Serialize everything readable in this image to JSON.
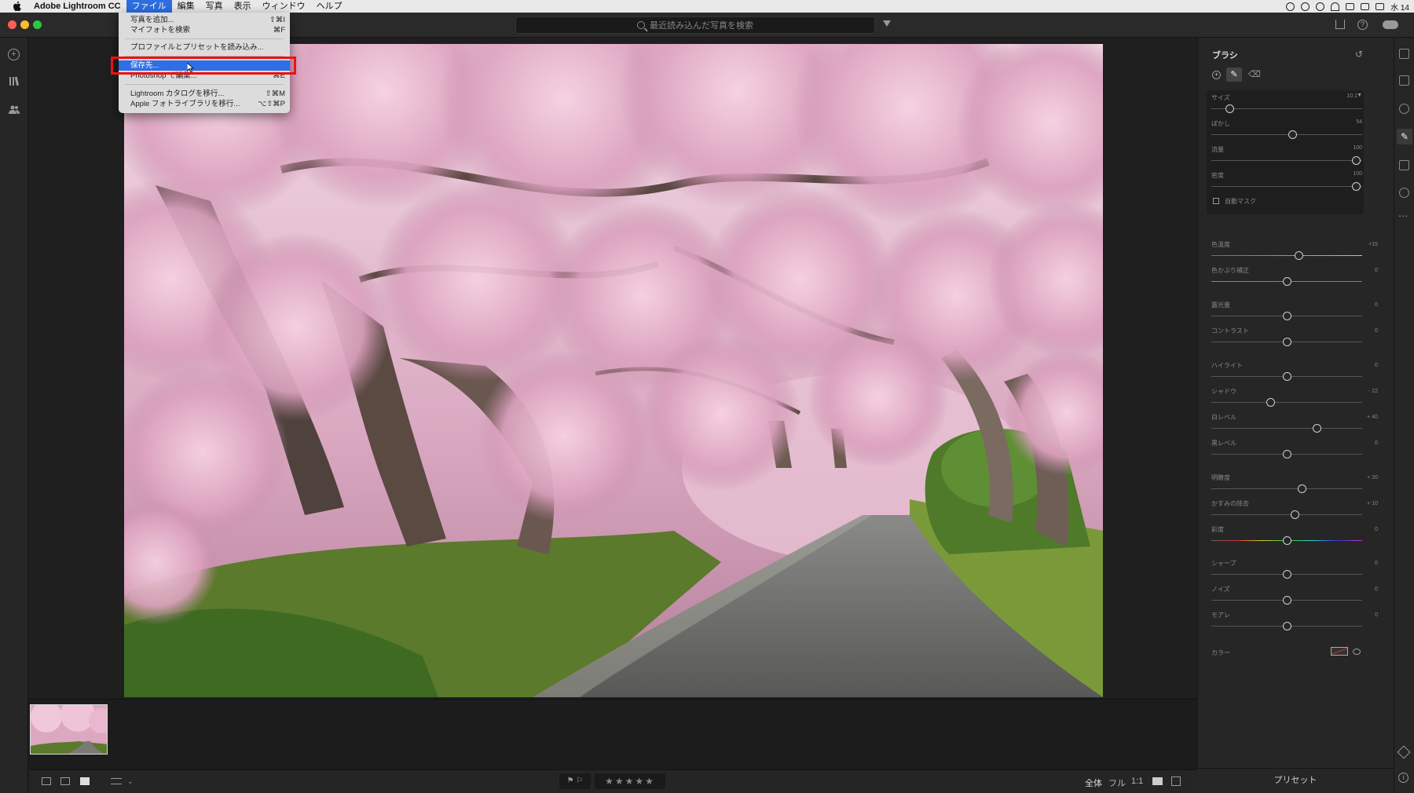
{
  "menubar": {
    "app_name": "Adobe Lightroom CC",
    "items": [
      "ファイル",
      "編集",
      "写真",
      "表示",
      "ウィンドウ",
      "ヘルプ"
    ],
    "clock": "水 14"
  },
  "toolbar": {
    "search_placeholder": "最近読み込んだ写真を検索"
  },
  "file_menu": {
    "items": [
      {
        "label": "写真を追加...",
        "shortcut": "⇧⌘I"
      },
      {
        "label": "マイフォトを検索",
        "shortcut": "⌘F"
      },
      {
        "label": "プロファイルとプリセットを読み込み...",
        "shortcut": ""
      },
      {
        "label": "保存先...",
        "shortcut": ""
      },
      {
        "label": "Photoshop で編集...",
        "shortcut": "⌘E"
      },
      {
        "label": "Lightroom カタログを移行...",
        "shortcut": "⇧⌘M"
      },
      {
        "label": "Apple フォトライブラリを移行...",
        "shortcut": "⌥⇧⌘P"
      }
    ],
    "highlighted": "保存先..."
  },
  "brush_panel": {
    "title": "ブラシ",
    "size": {
      "label": "サイズ",
      "value": "10.1"
    },
    "feather": {
      "label": "ぼかし",
      "value": "54"
    },
    "flow": {
      "label": "流量",
      "value": "100"
    },
    "density": {
      "label": "密度",
      "value": "100"
    },
    "auto_mask": "自動マスク"
  },
  "adjustments": [
    {
      "label": "色温度",
      "value": "+15",
      "pos": 0.58
    },
    {
      "label": "色かぶり補正",
      "value": "0",
      "pos": 0.5
    },
    {
      "label": "露光量",
      "value": "0",
      "pos": 0.5
    },
    {
      "label": "コントラスト",
      "value": "0",
      "pos": 0.5
    },
    {
      "label": "ハイライト",
      "value": "0",
      "pos": 0.5
    },
    {
      "label": "シャドウ",
      "value": "- 22",
      "pos": 0.39
    },
    {
      "label": "白レベル",
      "value": "+ 40",
      "pos": 0.7
    },
    {
      "label": "黒レベル",
      "value": "0",
      "pos": 0.5
    },
    {
      "label": "明瞭度",
      "value": "+ 20",
      "pos": 0.6
    },
    {
      "label": "かすみの除去",
      "value": "+ 10",
      "pos": 0.55
    },
    {
      "label": "彩度",
      "value": "0",
      "pos": 0.5
    },
    {
      "label": "シャープ",
      "value": "0",
      "pos": 0.5
    },
    {
      "label": "ノイズ",
      "value": "0",
      "pos": 0.5
    },
    {
      "label": "モアレ",
      "value": "0",
      "pos": 0.5
    }
  ],
  "color_label": "カラー",
  "bottombar": {
    "view_all": "全体",
    "view_full": "フル",
    "view_1to1": "1:1",
    "presets": "プリセット"
  }
}
